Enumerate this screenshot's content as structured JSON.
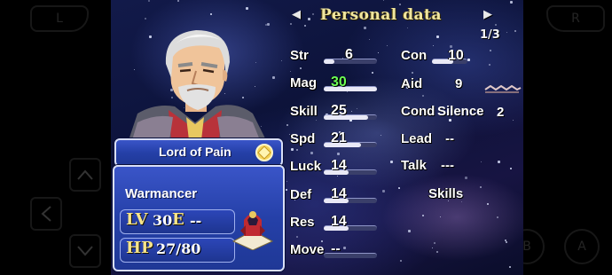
{
  "emulator": {
    "buttons": [
      "L",
      "R",
      "B",
      "A"
    ],
    "dpad": [
      "up-icon",
      "left-icon",
      "down-icon"
    ]
  },
  "screen": {
    "title": "Personal data",
    "page": "1/3"
  },
  "unit": {
    "name": "Lord of Pain",
    "class": "Warmancer",
    "lv_label": "LV",
    "lv_value": "30",
    "exp_label": "E",
    "exp_value": "--",
    "hp_label": "HP",
    "hp_value": "27/80",
    "affinity_icon": "light-affinity-icon"
  },
  "stats_left": [
    {
      "label": "Str",
      "value": "6",
      "bar": 0.2
    },
    {
      "label": "Mag",
      "value": "30",
      "bar": 1.0,
      "highlight": true
    },
    {
      "label": "Skill",
      "value": "25",
      "bar": 0.83
    },
    {
      "label": "Spd",
      "value": "21",
      "bar": 0.7
    },
    {
      "label": "Luck",
      "value": "14",
      "bar": 0.47
    },
    {
      "label": "Def",
      "value": "14",
      "bar": 0.47
    },
    {
      "label": "Res",
      "value": "14",
      "bar": 0.47
    },
    {
      "label": "Move",
      "value": "--",
      "bar": 0.0
    }
  ],
  "stats_right": {
    "con_label": "Con",
    "con_value": "10",
    "aid_label": "Aid",
    "aid_value": "9",
    "cond_label": "Cond",
    "cond_value": "Silence",
    "cond_turns": "2",
    "lead_label": "Lead",
    "lead_value": "--",
    "talk_label": "Talk",
    "talk_value": "---",
    "skills_label": "Skills"
  },
  "colors": {
    "highlight_value": "#6dff56",
    "panel_blue": "#2540a8",
    "title_gold": "#f0e6a0"
  }
}
